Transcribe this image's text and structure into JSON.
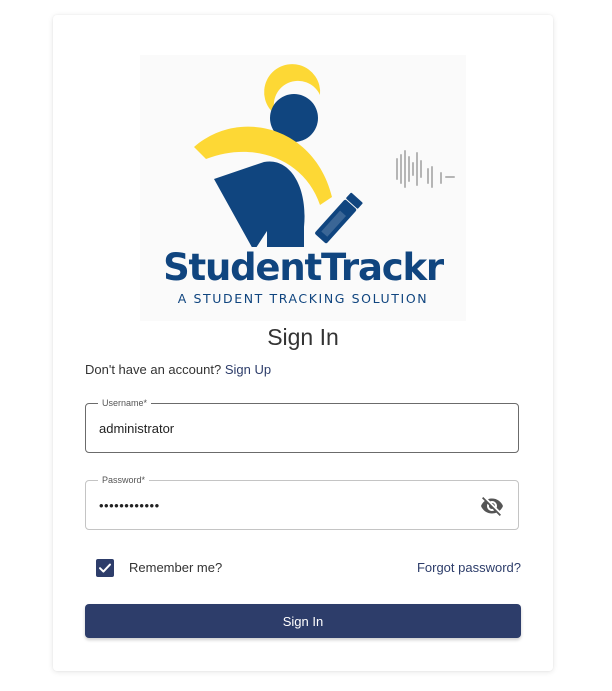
{
  "brand": {
    "name": "StudentTrackr",
    "tagline": "A STUDENT TRACKING SOLUTION",
    "colors": {
      "navy": "#10457f",
      "yellow": "#fdd835"
    }
  },
  "signin": {
    "title": "Sign In",
    "no_account_text": "Don't have an account?",
    "signup_link": "Sign Up",
    "username_label": "Username*",
    "username_value": "administrator",
    "password_label": "Password*",
    "password_value": "••••••••••••",
    "password_visibility_icon": "eye-off-icon",
    "remember_label": "Remember me?",
    "remember_checked": true,
    "forgot_link": "Forgot password?",
    "submit_label": "Sign In"
  },
  "theme": {
    "primary": "#2d3d6a"
  }
}
